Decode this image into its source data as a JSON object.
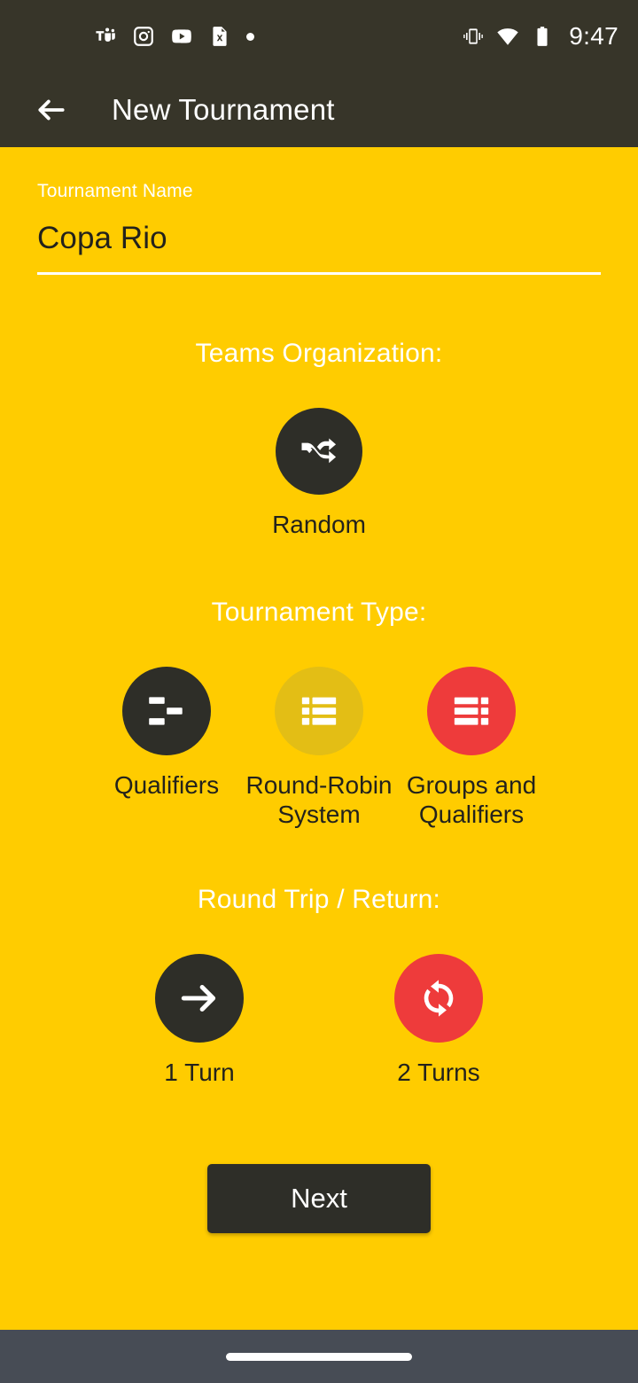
{
  "status_bar": {
    "time": "9:47",
    "left_icons": [
      {
        "name": "microsoft-teams-icon"
      },
      {
        "name": "instagram-icon"
      },
      {
        "name": "youtube-icon"
      },
      {
        "name": "excel-file-icon"
      },
      {
        "name": "notification-dot-icon"
      }
    ],
    "right_icons": [
      {
        "name": "vibrate-mode-icon"
      },
      {
        "name": "wifi-icon"
      },
      {
        "name": "battery-icon"
      }
    ]
  },
  "app_bar": {
    "back_icon": "back-arrow-icon",
    "title": "New Tournament"
  },
  "form": {
    "name_label": "Tournament Name",
    "name_value": "Copa Rio",
    "name_placeholder": "Tournament Name"
  },
  "teams_organization": {
    "title": "Teams Organization:",
    "options": [
      {
        "label": "Random",
        "icon": "shuffle-icon",
        "state": "selected",
        "color": "#2e2e28"
      }
    ]
  },
  "tournament_type": {
    "title": "Tournament Type:",
    "options": [
      {
        "label": "Qualifiers",
        "icon": "bracket-icon",
        "state": "selected",
        "color": "#2e2e28"
      },
      {
        "label": "Round-Robin System",
        "icon": "list-icon",
        "state": "muted",
        "color": "#E3BE15"
      },
      {
        "label": "Groups and Qualifiers",
        "icon": "groups-list-icon",
        "state": "unselected",
        "color": "#EE3B3B"
      }
    ]
  },
  "round_trip": {
    "title": "Round Trip / Return:",
    "options": [
      {
        "label": "1 Turn",
        "icon": "arrow-right-icon",
        "state": "selected",
        "color": "#2e2e28"
      },
      {
        "label": "2 Turns",
        "icon": "repeat-icon",
        "state": "unselected",
        "color": "#EE3B3B"
      }
    ]
  },
  "actions": {
    "next_label": "Next"
  },
  "nav_bar": {
    "handle": "home-gesture-handle"
  },
  "colors": {
    "background": "#FFCC00",
    "header": "#373529",
    "dark": "#2e2e28",
    "accent_red": "#EE3B3B",
    "muted_yellow": "#E3BE15",
    "nav": "#474C55"
  }
}
